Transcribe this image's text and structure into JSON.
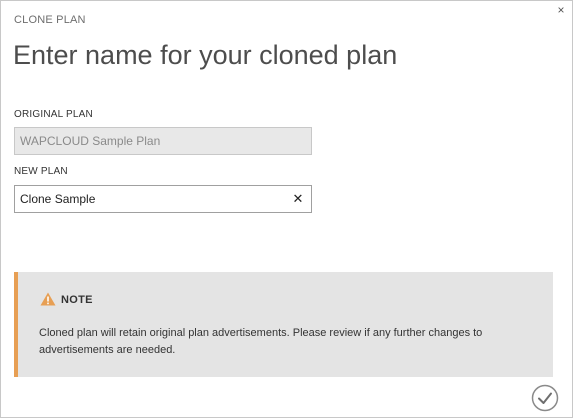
{
  "dialog": {
    "wizard_label": "CLONE PLAN",
    "title": "Enter name for your cloned plan",
    "close_glyph": "×"
  },
  "original_plan": {
    "label": "ORIGINAL PLAN",
    "value": "WAPCLOUD Sample Plan"
  },
  "new_plan": {
    "label": "NEW PLAN",
    "value": "Clone Sample",
    "clear_glyph": "✕"
  },
  "note": {
    "title": "NOTE",
    "text": "Cloned plan will retain original plan advertisements. Please review if any further changes to advertisements are needed.",
    "icon": "warning-icon",
    "accent_color": "#e79f54"
  },
  "footer": {
    "confirm_icon": "checkmark-icon"
  }
}
